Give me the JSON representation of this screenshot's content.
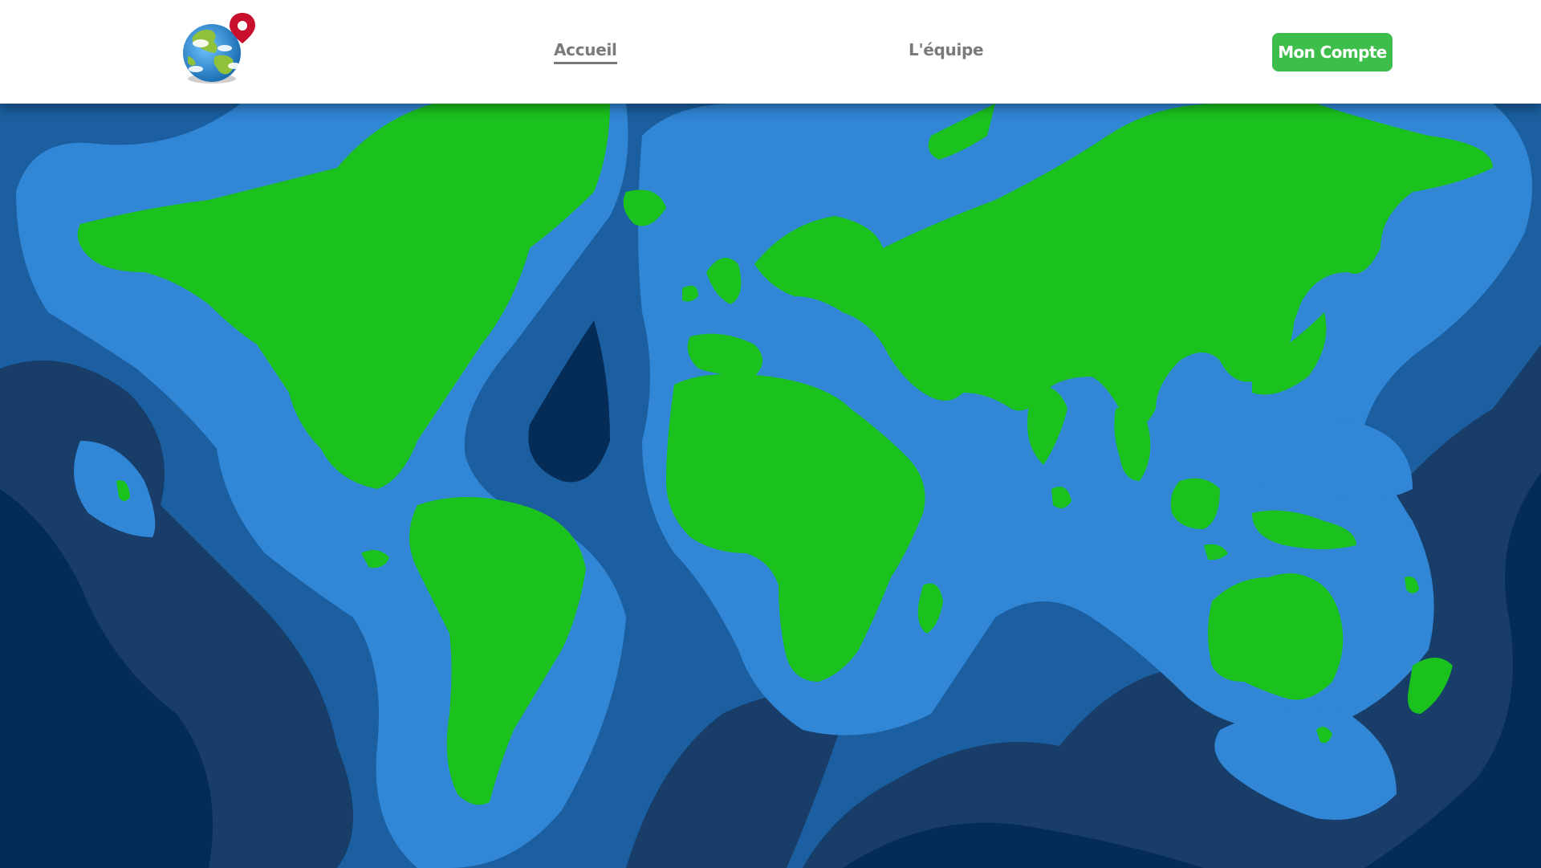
{
  "header": {
    "logo_icon": "globe-pin-icon",
    "nav": {
      "home_label": "Accueil",
      "team_label": "L'équipe"
    },
    "account_button_label": "Mon Compte"
  },
  "hero": {
    "image": "world-map-illustration"
  },
  "colors": {
    "accent_green": "#3dbd4a",
    "land_green": "#1bc21e",
    "shallow_water": "#3186d6",
    "mid_water": "#1b5fa0",
    "deep_water": "#173d68",
    "deepest_water": "#052b57"
  }
}
